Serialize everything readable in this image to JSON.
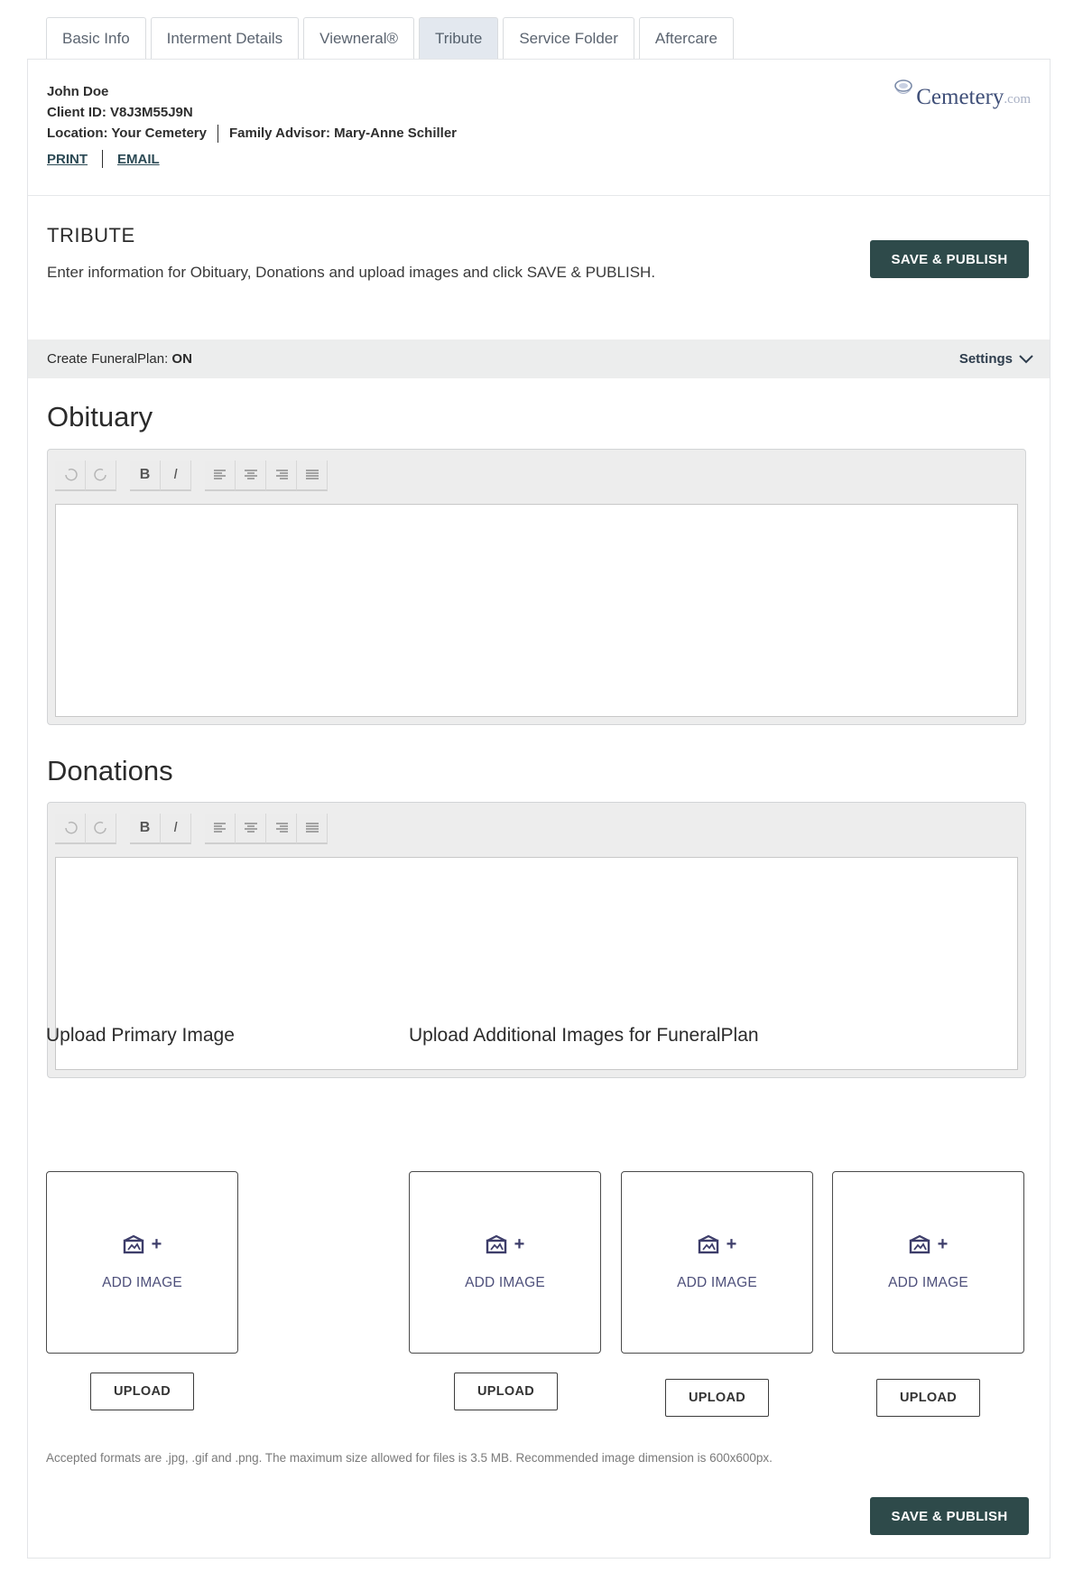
{
  "tabs": [
    {
      "label": "Basic Info"
    },
    {
      "label": "Interment Details"
    },
    {
      "label": "Viewneral®"
    },
    {
      "label": "Tribute"
    },
    {
      "label": "Service Folder"
    },
    {
      "label": "Aftercare"
    }
  ],
  "client": {
    "name": "John Doe",
    "client_id": "Client ID: V8J3M55J9N",
    "location": "Location: Your Cemetery",
    "advisor": "Family Advisor: Mary-Anne Schiller"
  },
  "links": {
    "print": "PRINT",
    "email": "EMAIL"
  },
  "logo": {
    "word": "Cemetery",
    "suffix": ".com"
  },
  "tribute": {
    "title": "TRIBUTE",
    "description": "Enter information for Obituary, Donations and upload images and click SAVE & PUBLISH.",
    "save_label": "SAVE & PUBLISH"
  },
  "settings_bar": {
    "label": "Create FuneralPlan: ",
    "state": "ON",
    "toggle_label": "Settings"
  },
  "obituary": {
    "title": "Obituary",
    "content": ""
  },
  "donations": {
    "title": "Donations",
    "content": ""
  },
  "toolbar": {
    "bold": "B",
    "italic": "I"
  },
  "uploads": {
    "primary_title": "Upload Primary Image",
    "additional_title": "Upload Additional Images for FuneralPlan",
    "add_image_label": "ADD IMAGE",
    "plus": "+",
    "upload_label": "UPLOAD",
    "note": "Accepted formats are .jpg, .gif and .png. The maximum size allowed for files is 3.5 MB. Recommended image dimension is 600x600px."
  },
  "footer": {
    "save_label": "SAVE & PUBLISH"
  },
  "colors": {
    "accent_dark": "#2e4a4a",
    "active_tab": "#e3e8ef",
    "settings_bar": "#eceded"
  }
}
